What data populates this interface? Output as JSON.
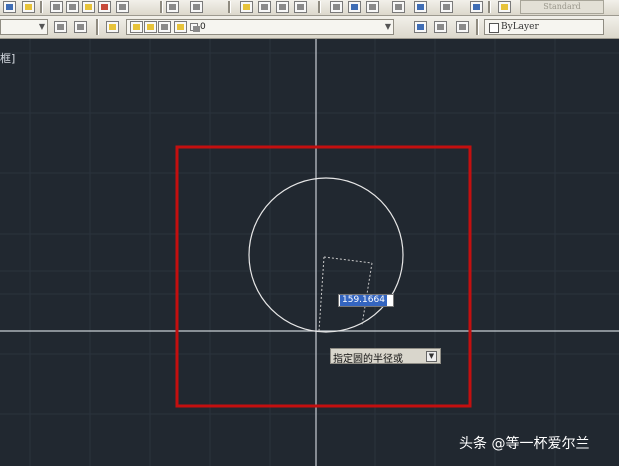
{
  "toolbar": {
    "text_style": "Standard",
    "layer_value": "0",
    "color_value": "ByLayer"
  },
  "viewport": {
    "label": "框]"
  },
  "command": {
    "radius_value": "159.1664",
    "prompt": "指定圆的半径或"
  },
  "watermark": {
    "text": "头条 @等一杯爱尔兰"
  },
  "colors": {
    "canvas_background": "#212830",
    "highlight_box": "#c40f0f",
    "circle": "#e6e6e6",
    "crosshair": "#c8cdd4",
    "input_selection": "#3465c0"
  }
}
